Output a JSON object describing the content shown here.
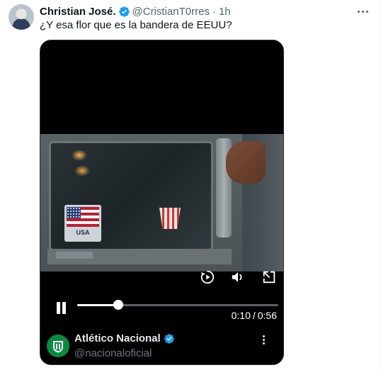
{
  "tweet": {
    "author": {
      "display_name": "Christian José.",
      "handle": "@CristianT0rres",
      "verified": true
    },
    "separator": "·",
    "time": "1h",
    "text": "¿Y esa flor que es la bandera de EEUU?"
  },
  "video": {
    "sticker_text": "USA",
    "progress_fraction": 0.204,
    "current_time": "0:10",
    "time_separator": "/",
    "duration": "0:56",
    "controls": [
      "replay-icon",
      "volume-icon",
      "expand-icon",
      "pause-icon"
    ]
  },
  "source": {
    "name": "Atlético Nacional",
    "handle": "@nacionaloficial",
    "verified": true
  },
  "colors": {
    "verified_blue": "#1d9bf0",
    "text_primary": "#0f1419",
    "text_secondary": "#536471",
    "media_background": "#000000",
    "source_logo_green": "#0b8a43"
  }
}
